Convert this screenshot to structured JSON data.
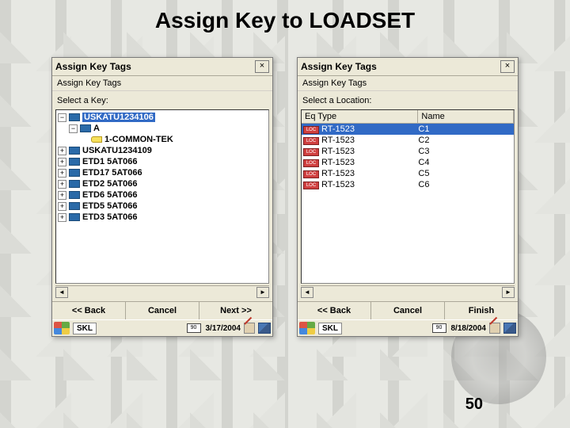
{
  "title": "Assign Key to LOADSET",
  "page_number": "50",
  "left": {
    "window_title": "Assign Key Tags",
    "subheader": "Assign Key Tags",
    "prompt": "Select a Key:",
    "tree": [
      {
        "exp": "−",
        "label": "USKATU1234106",
        "indent": 0,
        "selected": true,
        "icon": "sti"
      },
      {
        "exp": "−",
        "label": "A",
        "indent": 1,
        "icon": "eq"
      },
      {
        "exp": "",
        "label": "1-COMMON-TEK",
        "indent": 2,
        "icon": "key"
      },
      {
        "exp": "+",
        "label": "USKATU1234109",
        "indent": 0,
        "icon": "sti"
      },
      {
        "exp": "+",
        "label": "ETD1 5AT066",
        "indent": 0,
        "icon": "sti"
      },
      {
        "exp": "+",
        "label": "ETD17 5AT066",
        "indent": 0,
        "icon": "sti"
      },
      {
        "exp": "+",
        "label": "ETD2 5AT066",
        "indent": 0,
        "icon": "sti"
      },
      {
        "exp": "+",
        "label": "ETD6 5AT066",
        "indent": 0,
        "icon": "sti"
      },
      {
        "exp": "+",
        "label": "ETD5 5AT066",
        "indent": 0,
        "icon": "sti"
      },
      {
        "exp": "+",
        "label": "ETD3 5AT066",
        "indent": 0,
        "icon": "sti"
      }
    ],
    "buttons": {
      "back": "<< Back",
      "cancel": "Cancel",
      "next": "Next >>"
    },
    "taskbar": {
      "label": "SKL",
      "battery": "90",
      "date": "3/17/2004"
    }
  },
  "right": {
    "window_title": "Assign Key Tags",
    "subheader": "Assign Key Tags",
    "prompt": "Select a Location:",
    "columns": {
      "a": "Eq Type",
      "b": "Name"
    },
    "rows": [
      {
        "eq": "RT-1523",
        "name": "C1",
        "selected": true
      },
      {
        "eq": "RT-1523",
        "name": "C2"
      },
      {
        "eq": "RT-1523",
        "name": "C3"
      },
      {
        "eq": "RT-1523",
        "name": "C4"
      },
      {
        "eq": "RT-1523",
        "name": "C5"
      },
      {
        "eq": "RT-1523",
        "name": "C6"
      }
    ],
    "buttons": {
      "back": "<< Back",
      "cancel": "Cancel",
      "finish": "Finish"
    },
    "taskbar": {
      "label": "SKL",
      "battery": "90",
      "date": "8/18/2004"
    }
  }
}
